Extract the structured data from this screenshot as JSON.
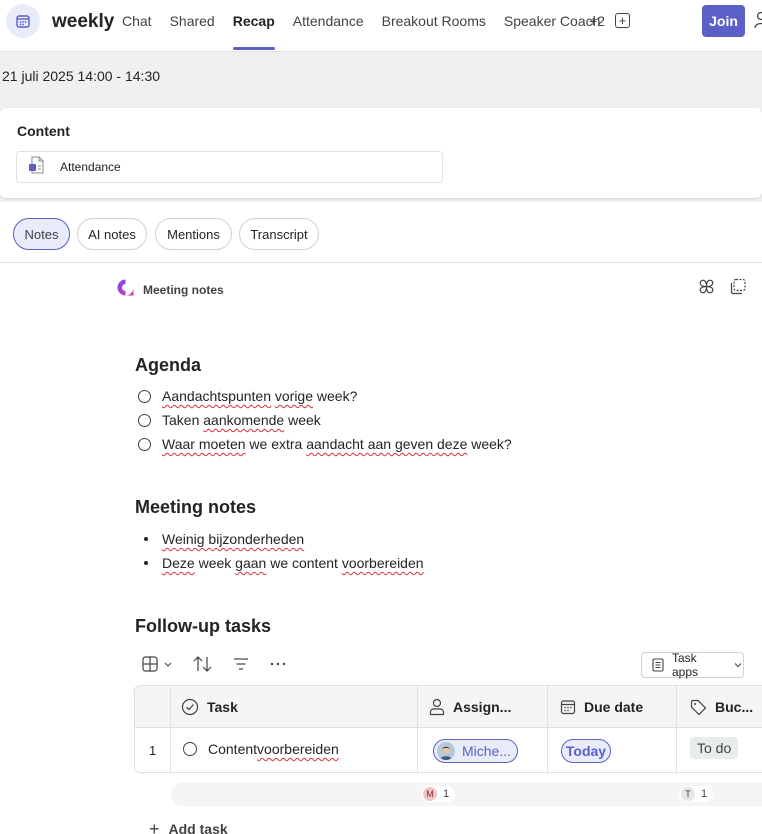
{
  "header": {
    "app_icon": "calendar-icon",
    "title": "weekly",
    "tabs": [
      {
        "label": "Chat",
        "active": false
      },
      {
        "label": "Shared",
        "active": false
      },
      {
        "label": "Recap",
        "active": true
      },
      {
        "label": "Attendance",
        "active": false
      },
      {
        "label": "Breakout Rooms",
        "active": false
      },
      {
        "label": "Speaker Coach",
        "active": false
      }
    ],
    "more_tabs": "+2",
    "join_label": "Join",
    "accent": "#5b5fc7"
  },
  "meeting": {
    "date_range": "21 juli 2025 14:00 - 14:30"
  },
  "content": {
    "title": "Content",
    "items": [
      {
        "label": "Attendance",
        "icon": "attendance-doc-icon"
      }
    ]
  },
  "notes_tabs": [
    {
      "label": "Notes",
      "active": true
    },
    {
      "label": "AI notes",
      "active": false
    },
    {
      "label": "Mentions",
      "active": false
    },
    {
      "label": "Transcript",
      "active": false
    }
  ],
  "loop": {
    "label": "Meeting notes",
    "icon": "loop-icon"
  },
  "agenda": {
    "heading": "Agenda",
    "items": [
      {
        "pre": "",
        "sq1": "Aandachtspunten",
        "mid": " ",
        "sq2": "vorige",
        "post": " week?"
      },
      {
        "pre": "Taken ",
        "sq1": "aankomende",
        "mid": "",
        "sq2": "",
        "post": " week"
      },
      {
        "pre": "",
        "sq1": "Waar moeten",
        "mid": " we extra ",
        "sq2": "aandacht aan geven deze",
        "post": " week?"
      }
    ]
  },
  "meeting_notes": {
    "heading": "Meeting notes",
    "items": [
      {
        "pre": "",
        "sq1": "Weinig bijzonderheden",
        "mid": "",
        "sq2": "",
        "post": ""
      },
      {
        "pre": "",
        "sq1": "Deze",
        "mid": " week ",
        "sq2": "gaan",
        "post": " we content ",
        "sq3": "voorbereiden"
      }
    ]
  },
  "tasks": {
    "heading": "Follow-up tasks",
    "task_apps_label": "Task apps",
    "columns": [
      "Task",
      "Assign...",
      "Due date",
      "Buc..."
    ],
    "rows": [
      {
        "num": "1",
        "task_pre": "Content ",
        "task_sq": "voorbereiden",
        "assignee": "Miche...",
        "due": "Today",
        "bucket": "To do"
      }
    ],
    "summary": [
      {
        "initial": "M",
        "count": "1",
        "color": "#f1c6c9"
      },
      {
        "initial": "T",
        "count": "1",
        "color": "#e6e6e6"
      }
    ],
    "add_label": "Add task"
  }
}
